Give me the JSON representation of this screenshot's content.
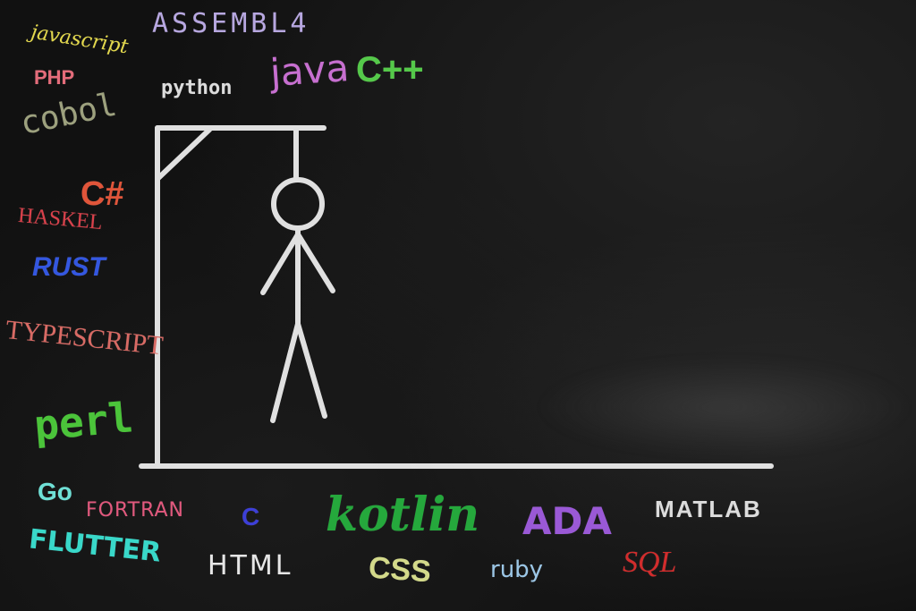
{
  "words": {
    "assembly": "ASSEMBL4",
    "javascript": "javascript",
    "php": "PHP",
    "python": "python",
    "java": "java",
    "cpp": "C++",
    "cobol": "cobol",
    "csharp": "C#",
    "haskel": "HASKEL",
    "rust": "RUST",
    "typescript": "TYPESCRIPT",
    "perl": "perl",
    "go": "Go",
    "fortran": "FORTRAN",
    "c": "C",
    "kotlin": "kotlin",
    "ada": "ADA",
    "matlab": "MATLAB",
    "flutter": "FLUTTER",
    "html": "HTML",
    "css": "CSS",
    "ruby": "ruby",
    "sql": "SQL"
  },
  "colors": {
    "chalk": "#f2f2f2",
    "assembly": "#b7a7e0",
    "javascript": "#e3d84c",
    "php": "#e46c7a",
    "python": "#dcdcdc",
    "java": "#c76fd0",
    "cpp": "#55c94a",
    "cobol": "#9da17e",
    "csharp": "#e0553a",
    "haskel": "#d9404a",
    "rust": "#3457e0",
    "typescript": "#d86a64",
    "perl": "#4bc43a",
    "go": "#6fe0d6",
    "fortran": "#e2587d",
    "c": "#3d3fd8",
    "kotlin": "#25a83c",
    "ada": "#9a59d6",
    "matlab": "#dcdcdc",
    "flutter": "#39d8c9",
    "html": "#e6e6e6",
    "css": "#d3d98a",
    "ruby": "#9bc6e6",
    "sql": "#d22c2c"
  },
  "hangman": {
    "wrong_guesses": 6,
    "parts_drawn": [
      "head",
      "body",
      "left-arm",
      "right-arm",
      "left-leg",
      "right-leg"
    ]
  }
}
